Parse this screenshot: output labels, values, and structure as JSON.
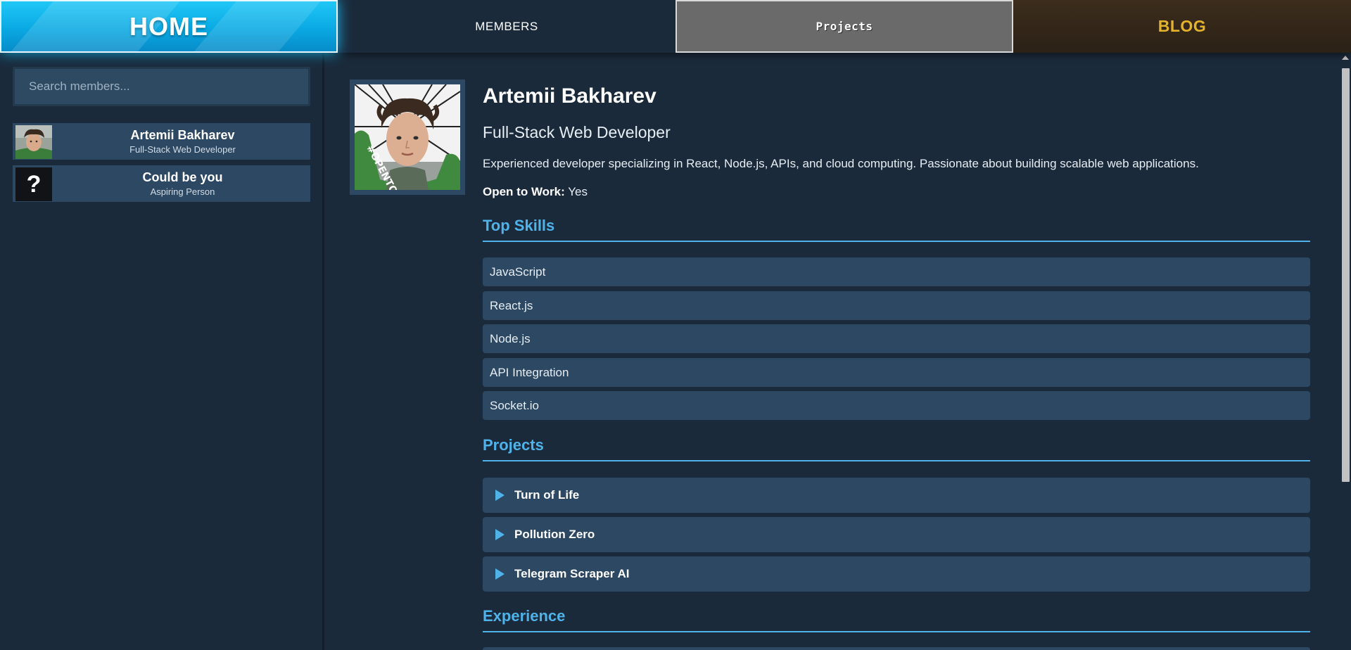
{
  "nav": {
    "home": "HOME",
    "members": "MEMBERS",
    "projects": "Projects",
    "blog": "BLOG"
  },
  "sidebar": {
    "search_placeholder": "Search members...",
    "members": [
      {
        "name": "Artemii Bakharev",
        "role": "Full-Stack Web Developer",
        "avatar": "photo"
      },
      {
        "name": "Could be you",
        "role": "Aspiring Person",
        "avatar": "question-mark-icon",
        "avatar_glyph": "?"
      }
    ]
  },
  "profile": {
    "name": "Artemii Bakharev",
    "title": "Full-Stack Web Developer",
    "description": "Experienced developer specializing in React, Node.js, APIs, and cloud computing. Passionate about building scalable web applications.",
    "open_to_work_label": "Open to Work:",
    "open_to_work_value": "Yes",
    "photo_badge_text": "#OPENTOWORK"
  },
  "skills": {
    "heading": "Top Skills",
    "items": [
      "JavaScript",
      "React.js",
      "Node.js",
      "API Integration",
      "Socket.io"
    ]
  },
  "projects": {
    "heading": "Projects",
    "items": [
      "Turn of Life",
      "Pollution Zero",
      "Telegram Scraper AI"
    ]
  },
  "experience": {
    "heading": "Experience"
  },
  "colors": {
    "background": "#1b2a3b",
    "panel": "#2c4863",
    "accent": "#4fb3ea",
    "home_tab": "#0aa9e3",
    "projects_tab": "#6a6a6a",
    "blog_text": "#e5b22c"
  }
}
